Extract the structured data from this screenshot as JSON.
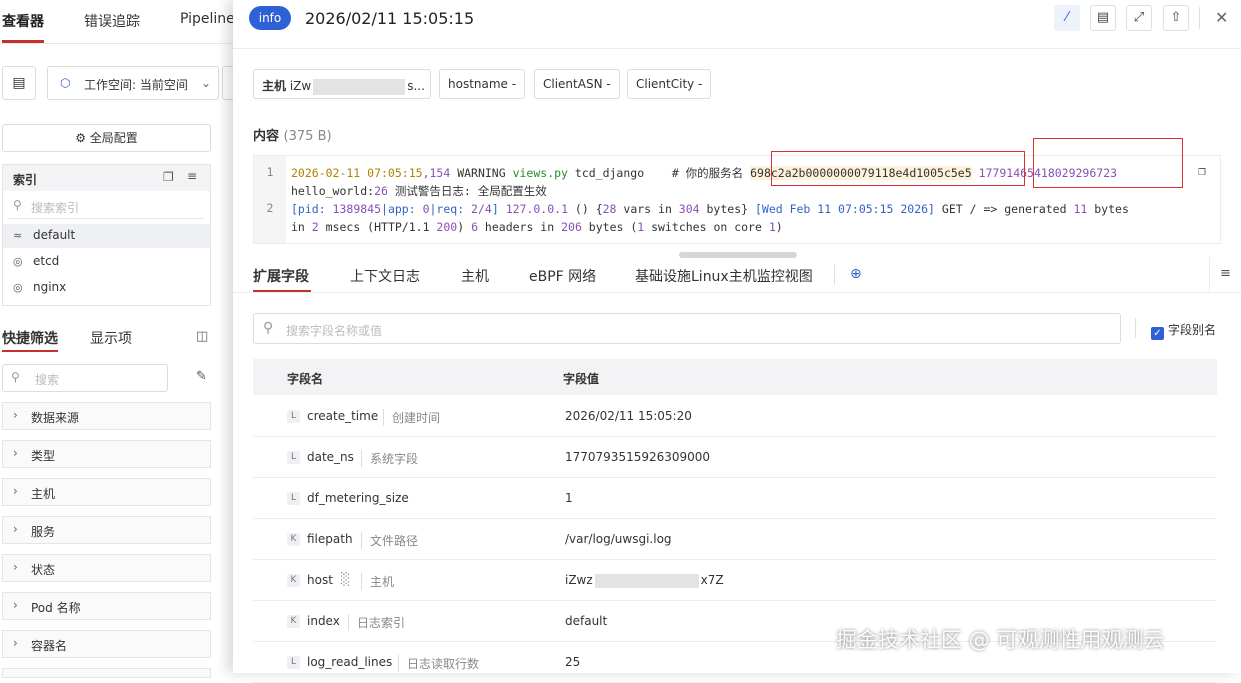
{
  "left": {
    "nav_tabs": [
      "查看器",
      "错误追踪",
      "Pipeline"
    ],
    "workspace_label": "工作空间: 当前空间",
    "global_config": "全局配置",
    "index": {
      "title": "索引",
      "search_placeholder": "搜索索引",
      "items": [
        "default",
        "etcd",
        "nginx"
      ]
    },
    "filter_tabs": [
      "快捷筛选",
      "显示项"
    ],
    "filter_search_placeholder": "搜索",
    "facets": [
      "数据来源",
      "类型",
      "主机",
      "服务",
      "状态",
      "Pod 名称",
      "容器名"
    ]
  },
  "drawer": {
    "level_badge": "info",
    "title": "2026/02/11 15:05:15",
    "tags": [
      {
        "label": "主机",
        "prefix": "iZw",
        "suffix": "s...",
        "masked": true
      },
      {
        "label": "hostname -"
      },
      {
        "label": "ClientASN -"
      },
      {
        "label": "ClientCity -"
      }
    ],
    "content_title": "内容",
    "content_size": "(375 B)",
    "code": {
      "line1_ts": "2026-02-11 07:05:15",
      "line1_ms": ",154",
      "line1_level": " WARNING ",
      "line1_file": "views.py",
      "line1_rest": " tcd_django    # 你的服务名 ",
      "line1_id1": "698c2a2b0000000079118e4d1005c5e5",
      "line1_id2": " 17791465418029296723",
      "line1_b_pre": "hello_world:",
      "line1_b_num": "26",
      "line1_b_rest": " 测试警告日志: 全局配置生效",
      "line2_a1": "[pid: ",
      "line2_a2": "1389845",
      "line2_a3": "|app: ",
      "line2_a4": "0",
      "line2_a5": "|req: ",
      "line2_a6": "2/4",
      "line2_a7": "] ",
      "line2_a8": "127.0.0.1",
      "line2_a9": " () {",
      "line2_a10": "28",
      "line2_a11": " vars in ",
      "line2_a12": "304",
      "line2_a13": " bytes} ",
      "line2_a14": "[Wed Feb 11 07:05:15 2026]",
      "line2_a15": " GET / => generated ",
      "line2_a16": "11",
      "line2_a17": " bytes",
      "line2_b1": "in ",
      "line2_b2": "2",
      "line2_b3": " msecs (HTTP/1.1 ",
      "line2_b4": "200",
      "line2_b5": ") ",
      "line2_b6": "6",
      "line2_b7": " headers in ",
      "line2_b8": "206",
      "line2_b9": " bytes (",
      "line2_b10": "1",
      "line2_b11": " switches on core ",
      "line2_b12": "1",
      "line2_b13": ")"
    },
    "tabs": [
      "扩展字段",
      "上下文日志",
      "主机",
      "eBPF 网络",
      "基础设施Linux主机监控视图"
    ],
    "field_search_placeholder": "搜索字段名称或值",
    "alias_label": "字段别名",
    "table_headers": [
      "字段名",
      "字段值"
    ],
    "rows": [
      {
        "type": "L",
        "name": "create_time",
        "alias": "创建时间",
        "value": "2026/02/11 15:05:20"
      },
      {
        "type": "L",
        "name": "date_ns",
        "alias": "系统字段",
        "value": "1770793515926309000"
      },
      {
        "type": "L",
        "name": "df_metering_size",
        "alias": "",
        "value": "1"
      },
      {
        "type": "K",
        "name": "filepath",
        "alias": "文件路径",
        "value": "/var/log/uwsgi.log"
      },
      {
        "type": "K",
        "name": "host",
        "alias": "主机",
        "value_prefix": "iZwz",
        "value_suffix": "x7Z"
      },
      {
        "type": "K",
        "name": "index",
        "alias": "日志索引",
        "value": "default"
      },
      {
        "type": "L",
        "name": "log_read_lines",
        "alias": "日志读取行数",
        "value": "25"
      }
    ]
  },
  "watermark": "掘金技术社区 @ 可观测性用观测云"
}
